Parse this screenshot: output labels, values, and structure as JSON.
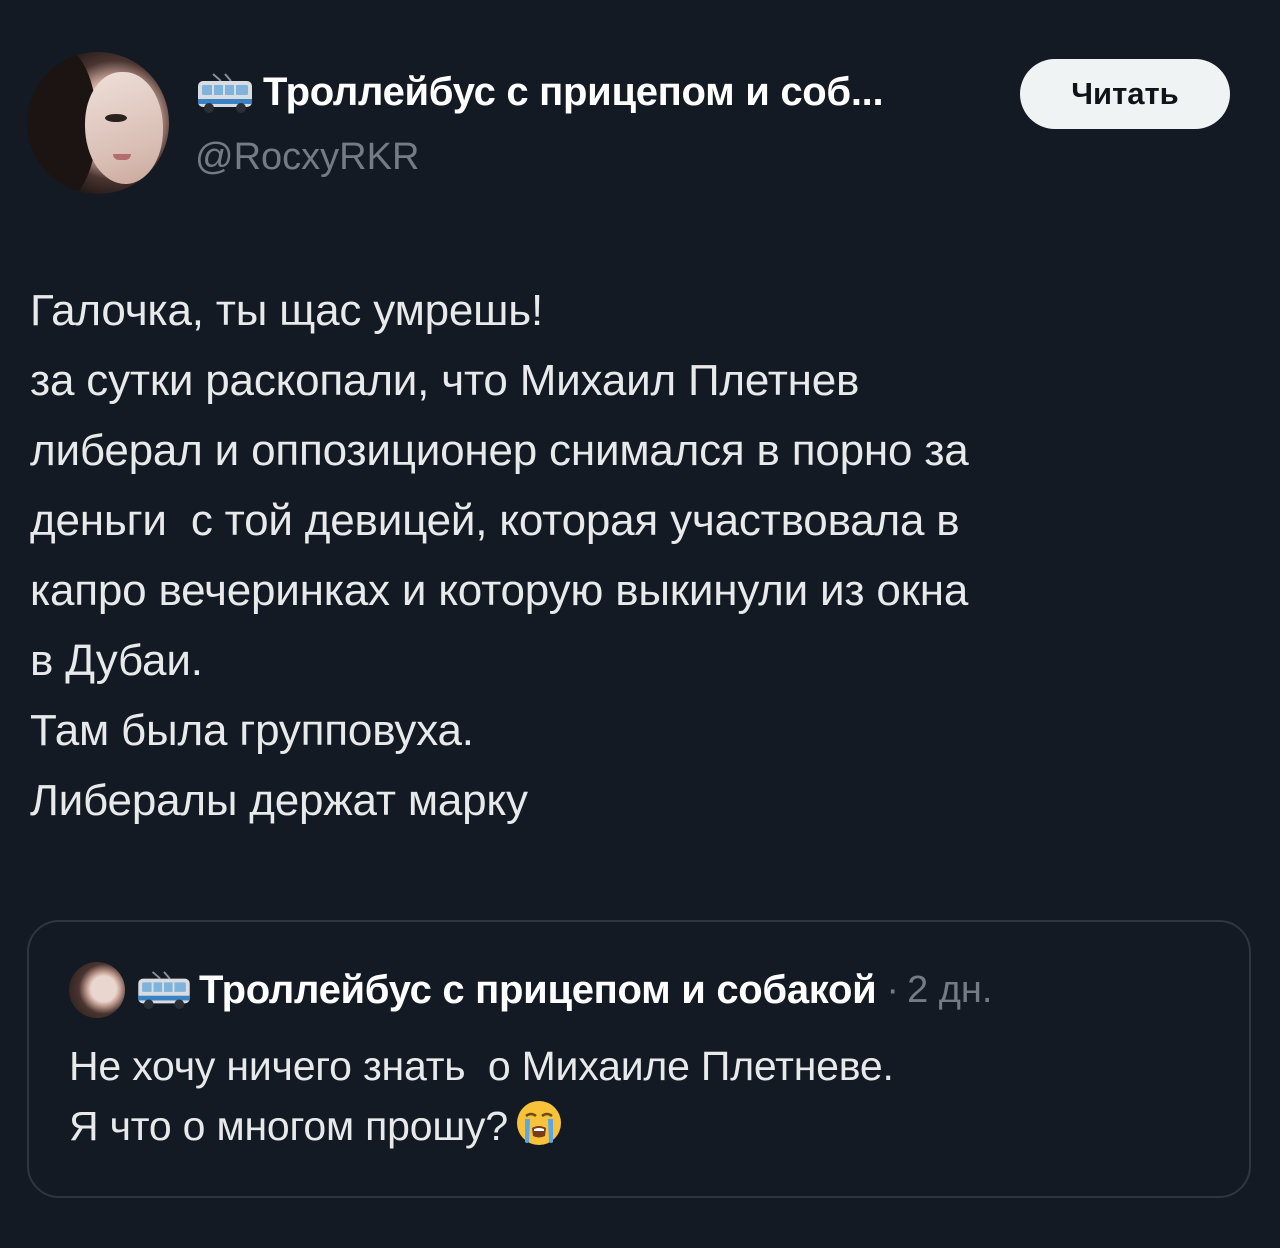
{
  "tweet": {
    "author": {
      "display_name": "Троллейбус с прицепом и соб...",
      "handle": "@RocxyRKR",
      "emoji_icon": "trolleybus-icon"
    },
    "follow_button": "Читать",
    "text_lines": [
      "Галочка, ты щас умрешь!",
      "за сутки раскопали, что Михаил Плетнев",
      "либерал и оппозиционер снимался в порно за",
      "деньги  с той девицей, которая участвовала в",
      "капро вечеринках и которую выкинули из окна",
      "в Дубаи.",
      "Там была групповуха.",
      "Либералы держат марку"
    ]
  },
  "quoted_tweet": {
    "author": {
      "display_name": "Троллейбус с прицепом и собакой",
      "emoji_icon": "trolleybus-icon"
    },
    "separator": "·",
    "time": "2 дн.",
    "text_lines": [
      "Не хочу ничего знать  о Михаиле Плетневе.",
      "Я что о многом прошу?"
    ],
    "trailing_emoji": "loudly-crying-face-icon"
  },
  "colors": {
    "background": "#141a23",
    "text_primary": "#e7e9ea",
    "text_secondary": "#737b86",
    "border": "#2f3640",
    "button_bg": "#eff3f4"
  }
}
